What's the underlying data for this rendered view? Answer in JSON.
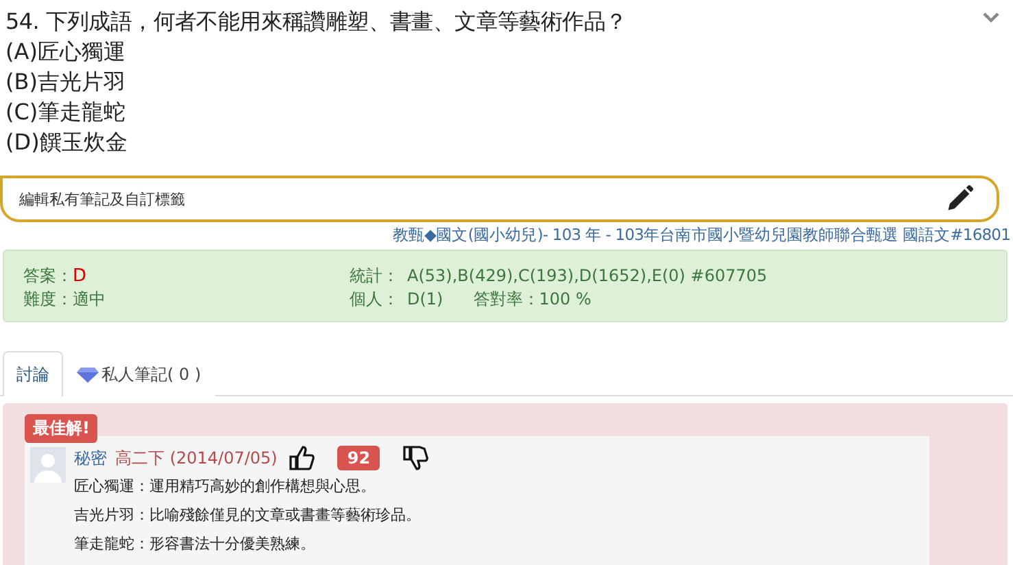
{
  "question": {
    "title": "54. 下列成語，何者不能用來稱讚雕塑、書畫、文章等藝術作品？",
    "options": [
      "(A)匠心獨運",
      "(B)吉光片羽",
      "(C)筆走龍蛇",
      "(D)饌玉炊金"
    ]
  },
  "note_field": {
    "placeholder": "編輯私有筆記及自訂標籤"
  },
  "source": "教甄◆國文(國小幼兒)- 103 年 - 103年台南市國小暨幼兒園教師聯合甄選 國語文#16801",
  "info": {
    "answer_label": "答案：",
    "answer": "D",
    "difficulty_label": "難度：",
    "difficulty": "適中",
    "stats_label": "統計：",
    "stats": "A(53),B(429),C(193),D(1652),E(0) #607705",
    "personal_label": "個人：",
    "personal": "D(1)",
    "rate": "答對率：100 %"
  },
  "tabs": [
    {
      "label": "討論",
      "selected": true
    },
    {
      "label": "私人筆記( 0 )",
      "selected": false
    }
  ],
  "best_answer": {
    "badge": "最佳解!",
    "author": "秘密",
    "meta": "高二下 (2014/07/05)",
    "votes": "92",
    "lines": [
      "匠心獨運：運用精巧高妙的創作構想與心思。",
      "吉光片羽：比喻殘餘僅見的文章或書畫等藝術珍品。",
      "筆走龍蛇：形容書法十分優美熟練。"
    ]
  }
}
